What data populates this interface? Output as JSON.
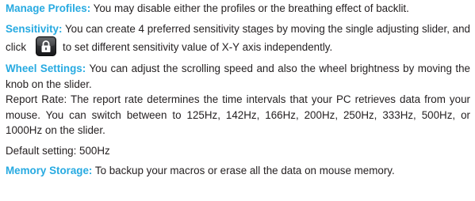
{
  "accent_color": "#27aae1",
  "text_color": "#231f20",
  "manage_profiles": {
    "term": "Manage Profiles:",
    "text": " You may disable either the profiles or the breathing effect of backlit."
  },
  "sensitivity": {
    "term": "Sensitivity:",
    "text_before": " You can create 4 preferred sensitivity stages by moving the single adjusting slider, and click",
    "icon": "lock-icon",
    "text_after": "to set different sensitivity value of X-Y axis independently."
  },
  "wheel_settings": {
    "term": "Wheel Settings:",
    "text": " You can adjust the scrolling speed and also the wheel brightness by moving the knob on the slider."
  },
  "report_rate": {
    "text": "Report Rate: The report rate determines the time intervals that your PC retrieves data from your mouse. You can switch between to 125Hz, 142Hz, 166Hz, 200Hz, 250Hz, 333Hz, 500Hz, or 1000Hz on the slider."
  },
  "default_setting": {
    "text": "Default setting: 500Hz"
  },
  "memory_storage": {
    "term": "Memory Storage:",
    "text": " To backup your macros or erase all the data on mouse memory."
  }
}
